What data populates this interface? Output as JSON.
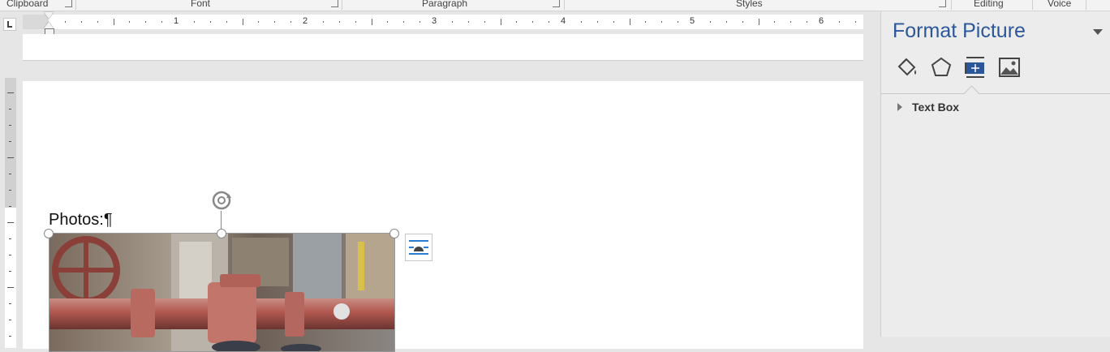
{
  "ribbon": {
    "groups": [
      {
        "label": "Clipboard"
      },
      {
        "label": "Font"
      },
      {
        "label": "Paragraph"
      },
      {
        "label": "Styles"
      },
      {
        "label": "Editing"
      },
      {
        "label": "Voice"
      }
    ]
  },
  "ruler": {
    "numbers": [
      "1",
      "2",
      "3",
      "4",
      "5",
      "6"
    ]
  },
  "document": {
    "paragraph_text": "Photos:¶",
    "picture_icon": "photo-pipes",
    "layout_options_icon": "layout-options-icon"
  },
  "task_pane": {
    "title": "Format Picture",
    "tabs": [
      {
        "icon": "fill-line-icon"
      },
      {
        "icon": "effects-icon"
      },
      {
        "icon": "layout-properties-icon"
      },
      {
        "icon": "picture-icon"
      }
    ],
    "sections": [
      {
        "label": "Text Box"
      }
    ]
  },
  "colors": {
    "accent": "#2b579a",
    "pane_bg": "#ececec",
    "canvas_bg": "#e6e6e6"
  }
}
